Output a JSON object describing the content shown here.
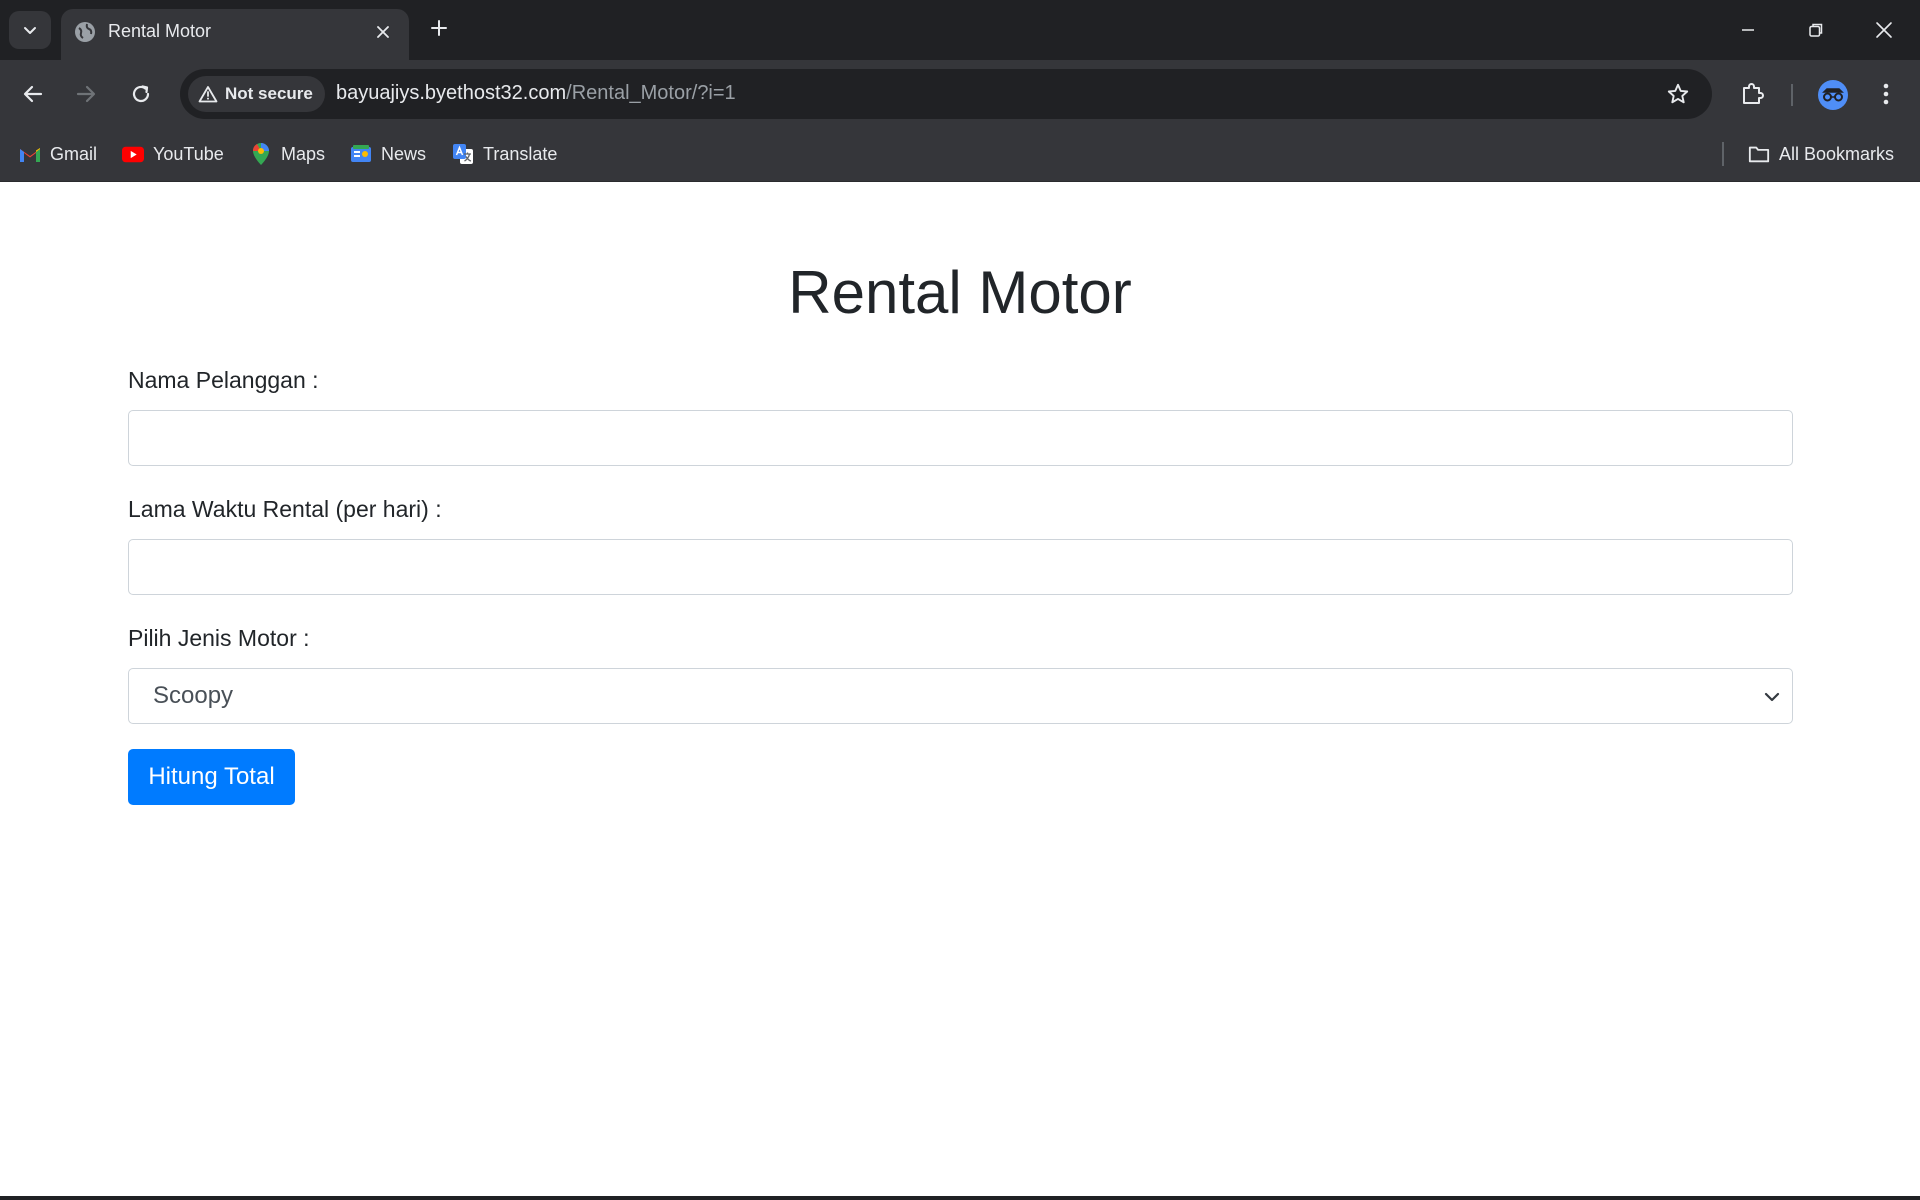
{
  "browser": {
    "tab": {
      "title": "Rental Motor",
      "favicon": "globe-icon"
    },
    "address": {
      "security_label": "Not secure",
      "url_host": "bayuajiys.byethost32.com",
      "url_path": "/Rental_Motor/?i=1"
    },
    "bookmarks": [
      {
        "label": "Gmail",
        "icon": "gmail-icon"
      },
      {
        "label": "YouTube",
        "icon": "youtube-icon"
      },
      {
        "label": "Maps",
        "icon": "maps-icon"
      },
      {
        "label": "News",
        "icon": "news-icon"
      },
      {
        "label": "Translate",
        "icon": "translate-icon"
      }
    ],
    "all_bookmarks_label": "All Bookmarks"
  },
  "page": {
    "title": "Rental Motor",
    "form": {
      "nama_label": "Nama Pelanggan :",
      "nama_value": "",
      "lama_label": "Lama Waktu Rental (per hari) :",
      "lama_value": "",
      "jenis_label": "Pilih Jenis Motor :",
      "jenis_selected": "Scoopy",
      "submit_label": "Hitung Total"
    }
  },
  "colors": {
    "primary": "#007bff",
    "chrome_dark": "#202124",
    "chrome_toolbar": "#35363a",
    "text": "#212529"
  }
}
